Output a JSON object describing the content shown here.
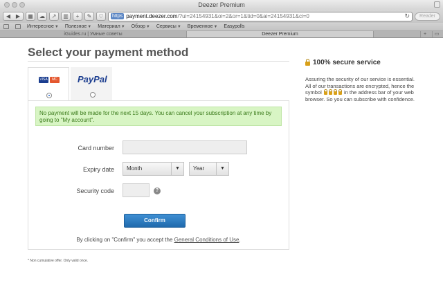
{
  "browser": {
    "window_title": "Deezer Premium",
    "address": {
      "scheme_badge": "https",
      "host": "payment.deezer.com",
      "path": "/?ui=24154931&oi=2&or=1&tid=0&ai=24154931&ci=0"
    },
    "reader_label": "Reader",
    "bookmarks": [
      {
        "label": "Интересное"
      },
      {
        "label": "Полезное"
      },
      {
        "label": "Материал"
      },
      {
        "label": "Обзор"
      },
      {
        "label": "Сервисы"
      },
      {
        "label": "Временное"
      },
      {
        "label": "Easypolls"
      }
    ],
    "tabs": [
      {
        "label": "iGuides.ru | Умные советы"
      },
      {
        "label": "Deezer Premium"
      }
    ],
    "plus_label": "+"
  },
  "page": {
    "heading": "Select your payment method",
    "methods": {
      "card": {
        "visa": "VISA",
        "mastercard": "MC",
        "selected": true
      },
      "paypal": {
        "label": "PayPal",
        "selected": false
      }
    },
    "notice": "No payment will be made for the next 15 days. You can cancel your subscription at any time by going to \"My account\".",
    "form": {
      "card_number_label": "Card number",
      "card_number_value": "",
      "expiry_label": "Expiry date",
      "month_value": "Month",
      "year_value": "Year",
      "security_label": "Security code",
      "security_value": "",
      "help_glyph": "?",
      "confirm_label": "Confirm",
      "terms_prefix": "By clicking on \"Confirm\" you accept the ",
      "terms_link": "General Conditions of Use",
      "terms_suffix": "."
    },
    "footnote": "* Non cumulative offer. Only valid once.",
    "sidebar": {
      "title": "100% secure service",
      "body_part1": "Assuring the security of our service is essential. All of our transactions are encrypted, hence the symbol",
      "body_part2": "in the address bar of your web browser. So you can subscribe with confidence."
    }
  }
}
